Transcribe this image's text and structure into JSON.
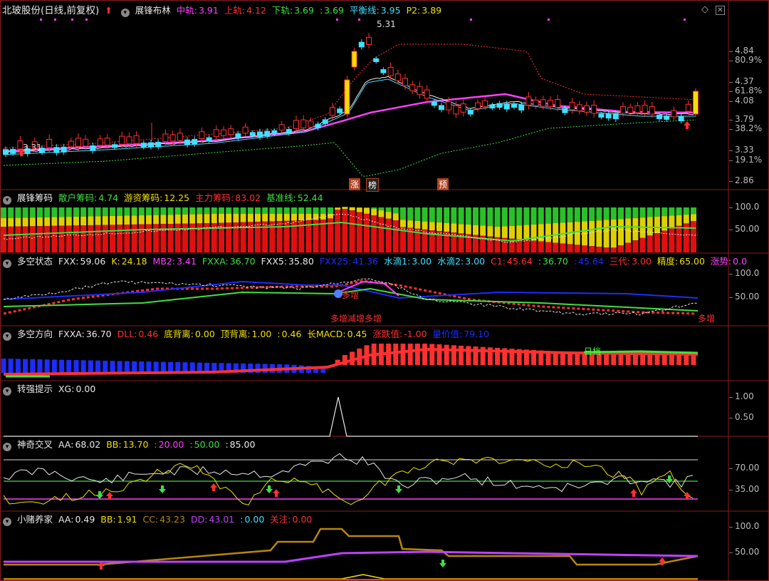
{
  "colors": {
    "red": "#ff3030",
    "green": "#3fe03f",
    "yellow": "#f0e000",
    "cyan": "#40e0ff",
    "magenta": "#ff40ff",
    "white": "#e8e8e8",
    "blue": "#1e2cff",
    "gray": "#a0a0a0",
    "orange": "#ff8c20",
    "violet": "#9a30ff",
    "brown": "#b8860b",
    "purple": "#c040ff"
  },
  "main": {
    "title": "北玻股份(日线,前复权)",
    "indicator": "展锋布林",
    "fields": [
      {
        "label": "中轨:",
        "value": "3.91",
        "color": "#ff40ff"
      },
      {
        "label": "上轨:",
        "value": "4.12",
        "color": "#ff3030"
      },
      {
        "label": "下轨:",
        "value": "3.69",
        "color": "#3fe03f"
      },
      {
        "label": ":",
        "value": "3.69",
        "color": "#3fe03f"
      },
      {
        "label": "平衡线:",
        "value": "3.95",
        "color": "#40e0ff"
      },
      {
        "label": "P2:",
        "value": "3.89",
        "color": "#f0e000"
      }
    ],
    "peak_label": "5.31",
    "low_label": "3.31",
    "axis": [
      "4.84",
      "80.9%",
      "4.37",
      "61.8%",
      "4.08",
      "3.79",
      "38.2%",
      "3.33",
      "19.1%",
      "2.86"
    ],
    "markers": [
      "涨",
      "榜",
      "预"
    ]
  },
  "chips": {
    "title": "展锋筹码",
    "fields": [
      {
        "label": "散户筹码:",
        "value": "4.74",
        "color": "#3fe03f"
      },
      {
        "label": "游资筹码:",
        "value": "12.25",
        "color": "#f0e000"
      },
      {
        "label": "主力筹码:",
        "value": "83.02",
        "color": "#ff3030"
      },
      {
        "label": "基准线:",
        "value": "52.44",
        "color": "#3fe03f"
      }
    ],
    "axis": [
      "100.0",
      "50.00"
    ]
  },
  "state": {
    "title": "多空状态",
    "fields": [
      {
        "label": "FXX:",
        "value": "59.06",
        "color": "#e8e8e8"
      },
      {
        "label": "K:",
        "value": "24.18",
        "color": "#f0e000"
      },
      {
        "label": "MB2:",
        "value": "3.41",
        "color": "#ff40ff"
      },
      {
        "label": "FXXA:",
        "value": "36.70",
        "color": "#3fe03f"
      },
      {
        "label": "FXX5:",
        "value": "35.80",
        "color": "#e8e8e8"
      },
      {
        "label": "FXX25:",
        "value": "41.36",
        "color": "#1e2cff"
      },
      {
        "label": "水滴1:",
        "value": "3.00",
        "color": "#40e0ff"
      },
      {
        "label": "水滴2:",
        "value": "3.00",
        "color": "#40e0ff"
      },
      {
        "label": "C1:",
        "value": "45.64",
        "color": "#ff3030"
      },
      {
        "label": ":",
        "value": "36.70",
        "color": "#3fe03f"
      },
      {
        "label": ":",
        "value": "45.64",
        "color": "#1e2cff"
      },
      {
        "label": "三代:",
        "value": "3.00",
        "color": "#ff3030"
      },
      {
        "label": "精度:",
        "value": "65.00",
        "color": "#f0e000"
      },
      {
        "label": "涨势:",
        "value": "0.0",
        "color": "#ff40ff"
      }
    ],
    "axis": [
      "100.0",
      "50.00"
    ],
    "notes": [
      "多增",
      "多增减增多增",
      "多增"
    ]
  },
  "direction": {
    "title": "多空方向",
    "fields": [
      {
        "label": "FXXA:",
        "value": "36.70",
        "color": "#e8e8e8"
      },
      {
        "label": "DLL:",
        "value": "0.46",
        "color": "#ff3030"
      },
      {
        "label": "底背离:",
        "value": "0.00",
        "color": "#f0e000"
      },
      {
        "label": "顶背离:",
        "value": "1.00",
        "color": "#f0e000"
      },
      {
        "label": ":",
        "value": "0.46",
        "color": "#f0e000"
      },
      {
        "label": "长MACD:",
        "value": "0.45",
        "color": "#f0e000"
      },
      {
        "label": "涨跌值:",
        "value": "-1.00",
        "color": "#ff3030"
      },
      {
        "label": "量价值:",
        "value": "79.10",
        "color": "#1e2cff"
      }
    ],
    "note": "日档"
  },
  "strong": {
    "title": "转强提示",
    "fields": [
      {
        "label": "XG:",
        "value": "0.00",
        "color": "#e8e8e8"
      }
    ],
    "axis": [
      "1.00",
      "0.50"
    ]
  },
  "magic": {
    "title": "神奇交叉",
    "fields": [
      {
        "label": "AA:",
        "value": "68.02",
        "color": "#e8e8e8"
      },
      {
        "label": "BB:",
        "value": "13.70",
        "color": "#f0e000"
      },
      {
        "label": ":",
        "value": "20.00",
        "color": "#ff40ff"
      },
      {
        "label": ":",
        "value": "50.00",
        "color": "#3fe03f"
      },
      {
        "label": ":",
        "value": "85.00",
        "color": "#e8e8e8"
      }
    ],
    "axis": [
      "70.00",
      "35.00"
    ]
  },
  "gambler": {
    "title": "小赌养家",
    "fields": [
      {
        "label": "AA:",
        "value": "0.49",
        "color": "#e8e8e8"
      },
      {
        "label": "BB:",
        "value": "1.91",
        "color": "#f0e000"
      },
      {
        "label": "CC:",
        "value": "43.23",
        "color": "#b8860b"
      },
      {
        "label": "DD:",
        "value": "43.01",
        "color": "#c040ff"
      },
      {
        "label": ":",
        "value": "0.00",
        "color": "#40e0ff"
      },
      {
        "label": "关注:",
        "value": "0.00",
        "color": "#ff3030"
      }
    ],
    "axis": [
      "100.0",
      "50.00"
    ]
  }
}
